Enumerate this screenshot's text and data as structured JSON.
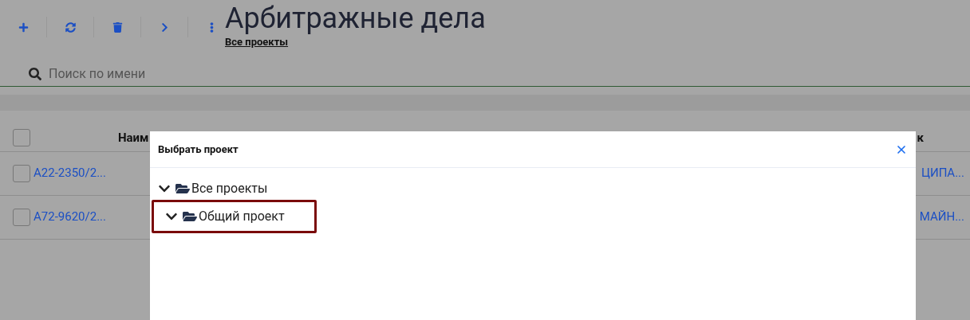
{
  "toolbar": [
    {
      "kind": "add"
    },
    {
      "kind": "refresh"
    },
    {
      "kind": "delete"
    },
    {
      "kind": "forward"
    },
    {
      "kind": "more"
    }
  ],
  "page": {
    "title": "Арбитражные дела",
    "breadcrumb": "Все проекты"
  },
  "search": {
    "placeholder": "Поиск по имени"
  },
  "table": {
    "select_all": {
      "checked": false
    },
    "columns": [
      "Наим",
      "к"
    ],
    "rows": [
      {
        "checked": false,
        "name": "А22-2350/2...",
        "defendant": "ЦИПА..."
      },
      {
        "checked": false,
        "name": "А72-9620/2...",
        "defendant": "МАЙН..."
      }
    ]
  },
  "dialog": {
    "title": "Выбрать проект",
    "tree": [
      {
        "label": "Все проекты",
        "expanded": true,
        "highlighted": false,
        "children": [
          {
            "label": "Общий проект",
            "expanded": true,
            "highlighted": true
          }
        ]
      }
    ]
  }
}
